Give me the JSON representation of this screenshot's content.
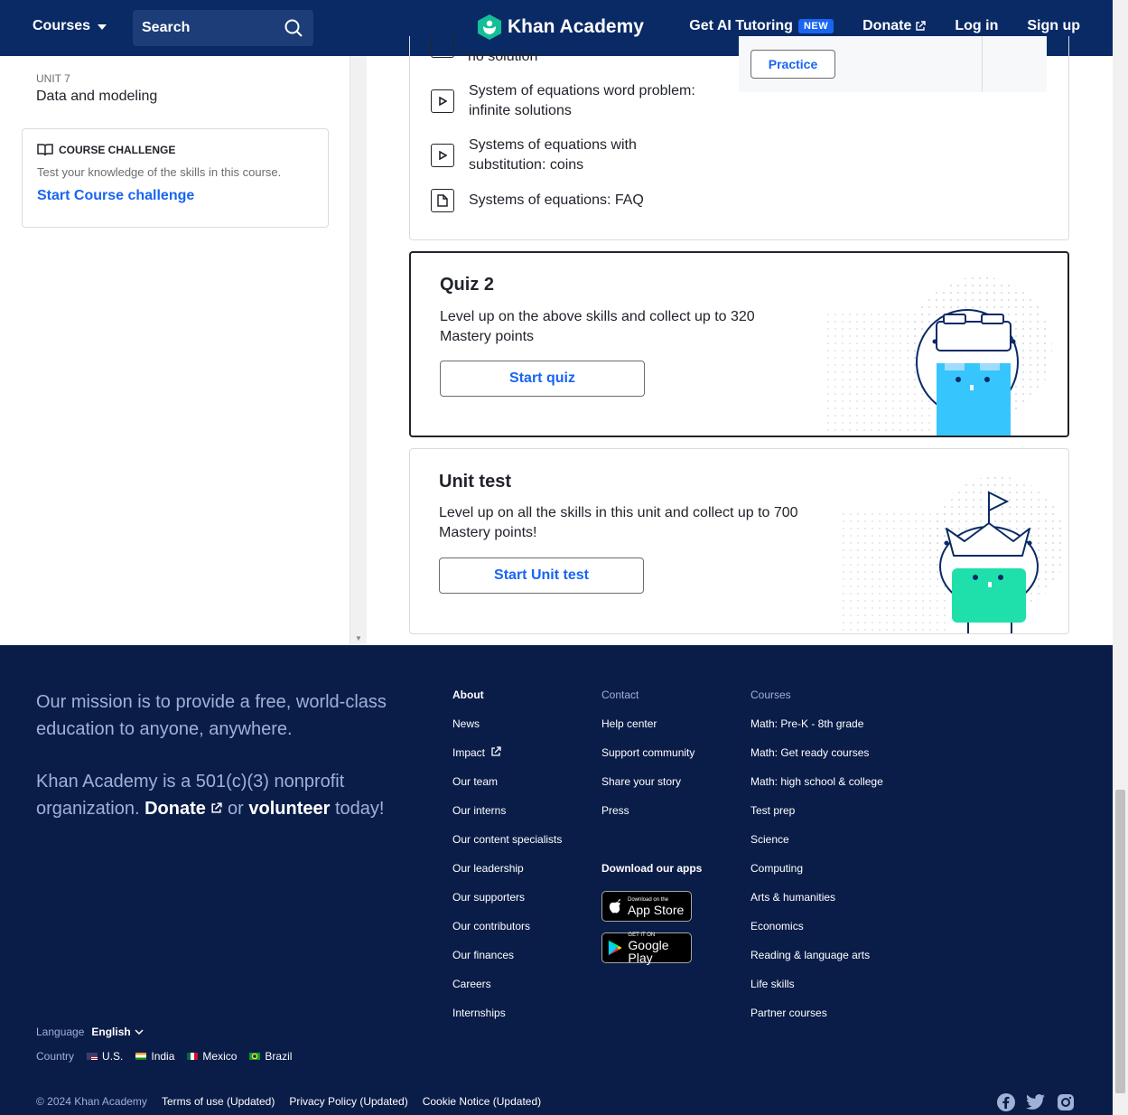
{
  "nav": {
    "courses": "Courses",
    "search": "Search",
    "logo": "Khan Academy",
    "ai_tutoring": "Get AI Tutoring",
    "new_badge": "NEW",
    "donate": "Donate",
    "login": "Log in",
    "signup": "Sign up"
  },
  "sidebar": {
    "unit_label": "UNIT 7",
    "unit_name": "Data and modeling",
    "challenge_heading": "COURSE CHALLENGE",
    "challenge_desc": "Test your knowledge of the skills in this course.",
    "challenge_link": "Start Course challenge"
  },
  "lessons": {
    "partial_text": "no solution",
    "practice_label": "Practice",
    "items": [
      {
        "type": "video",
        "title": "System of equations word problem: infinite solutions"
      },
      {
        "type": "video",
        "title": "Systems of equations with substitution: coins"
      },
      {
        "type": "article",
        "title": "Systems of equations: FAQ"
      }
    ]
  },
  "quiz": {
    "title": "Quiz 2",
    "desc": "Level up on the above skills and collect up to 320 Mastery points",
    "button": "Start quiz"
  },
  "unit_test": {
    "title": "Unit test",
    "desc": "Level up on all the skills in this unit and collect up to 700 Mastery points!",
    "button": "Start Unit test"
  },
  "footer": {
    "mission": "Our mission is to provide a free, world-class education to anyone, anywhere.",
    "nonprofit_1": "Khan Academy is a 501(c)(3) nonprofit organization.",
    "donate": "Donate",
    "or": "or",
    "volunteer": "volunteer",
    "today": "today!",
    "about_head": "About",
    "about_items": [
      "News",
      "Impact",
      "Our team",
      "Our interns",
      "Our content specialists",
      "Our leadership",
      "Our supporters",
      "Our contributors",
      "Our finances",
      "Careers",
      "Internships"
    ],
    "contact_head": "Contact",
    "contact_items": [
      "Help center",
      "Support community",
      "Share your story",
      "Press"
    ],
    "apps_head": "Download our apps",
    "appstore_small": "Download on the",
    "appstore_large": "App Store",
    "googleplay_small": "GET IT ON",
    "googleplay_large": "Google Play",
    "courses_head": "Courses",
    "courses_items": [
      "Math: Pre-K - 8th grade",
      "Math: Get ready courses",
      "Math: high school & college",
      "Test prep",
      "Science",
      "Computing",
      "Arts & humanities",
      "Economics",
      "Reading & language arts",
      "Life skills",
      "Partner courses"
    ],
    "language_label": "Language",
    "language_value": "English",
    "country_label": "Country",
    "countries": [
      "U.S.",
      "India",
      "Mexico",
      "Brazil"
    ],
    "copyright": "© 2024 Khan Academy",
    "terms": "Terms of use (Updated)",
    "privacy": "Privacy Policy (Updated)",
    "cookie": "Cookie Notice (Updated)"
  },
  "colors": {
    "nav_bg": "#0a2a66",
    "footer_bg": "#0a1d48",
    "link_blue": "#1865f2",
    "brand_green": "#14bf96"
  }
}
